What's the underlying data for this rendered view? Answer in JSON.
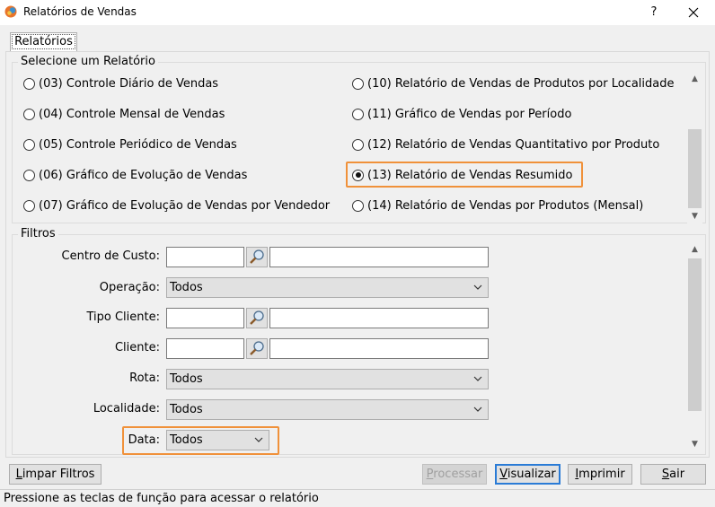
{
  "window": {
    "title": "Relatórios de Vendas",
    "help_label": "?",
    "close_label": "✕",
    "icon": "app-logo-icon"
  },
  "tab": {
    "label": "Relatórios"
  },
  "report_group": {
    "legend": "Selecione um Relatório",
    "selected": "(13) Relatório de Vendas Resumido",
    "options": [
      {
        "label": "(03) Controle Diário de Vendas",
        "checked": false
      },
      {
        "label": "(04) Controle Mensal de Vendas",
        "checked": false
      },
      {
        "label": "(05) Controle Periódico de Vendas",
        "checked": false
      },
      {
        "label": "(06) Gráfico de Evolução de Vendas",
        "checked": false
      },
      {
        "label": "(07) Gráfico de Evolução de Vendas por Vendedor",
        "checked": false
      },
      {
        "label": "(10) Relatório de Vendas de Produtos por Localidade",
        "checked": false
      },
      {
        "label": "(11) Gráfico de Vendas por Período",
        "checked": false
      },
      {
        "label": "(12) Relatório de Vendas Quantitativo por Produto",
        "checked": false
      },
      {
        "label": "(13) Relatório de Vendas Resumido",
        "checked": true
      },
      {
        "label": "(14) Relatório de Vendas por Produtos (Mensal)",
        "checked": false
      }
    ]
  },
  "filters": {
    "legend": "Filtros",
    "centro_custo": {
      "label": "Centro de Custo:",
      "code": "",
      "description": ""
    },
    "operacao": {
      "label": "Operação:",
      "value": "Todos"
    },
    "tipo_cliente": {
      "label": "Tipo Cliente:",
      "code": "",
      "description": ""
    },
    "cliente": {
      "label": "Cliente:",
      "code": "",
      "description": ""
    },
    "rota": {
      "label": "Rota:",
      "value": "Todos"
    },
    "localidade": {
      "label": "Localidade:",
      "value": "Todos"
    },
    "data": {
      "label": "Data:",
      "value": "Todos"
    }
  },
  "buttons": {
    "limpar": {
      "prefix": "",
      "mnemonic": "L",
      "rest": "impar Filtros"
    },
    "processar": {
      "prefix": "",
      "mnemonic": "P",
      "rest": "rocessar"
    },
    "visualizar": {
      "prefix": "",
      "mnemonic": "V",
      "rest": "isualizar"
    },
    "imprimir": {
      "prefix": "",
      "mnemonic": "I",
      "rest": "mprimir"
    },
    "sair": {
      "prefix": "",
      "mnemonic": "S",
      "rest": "air"
    }
  },
  "status": {
    "text": "Pressione as teclas de função para acessar o relatório"
  },
  "colors": {
    "highlight": "#f0913a",
    "default_button_border": "#2a7bd6"
  }
}
